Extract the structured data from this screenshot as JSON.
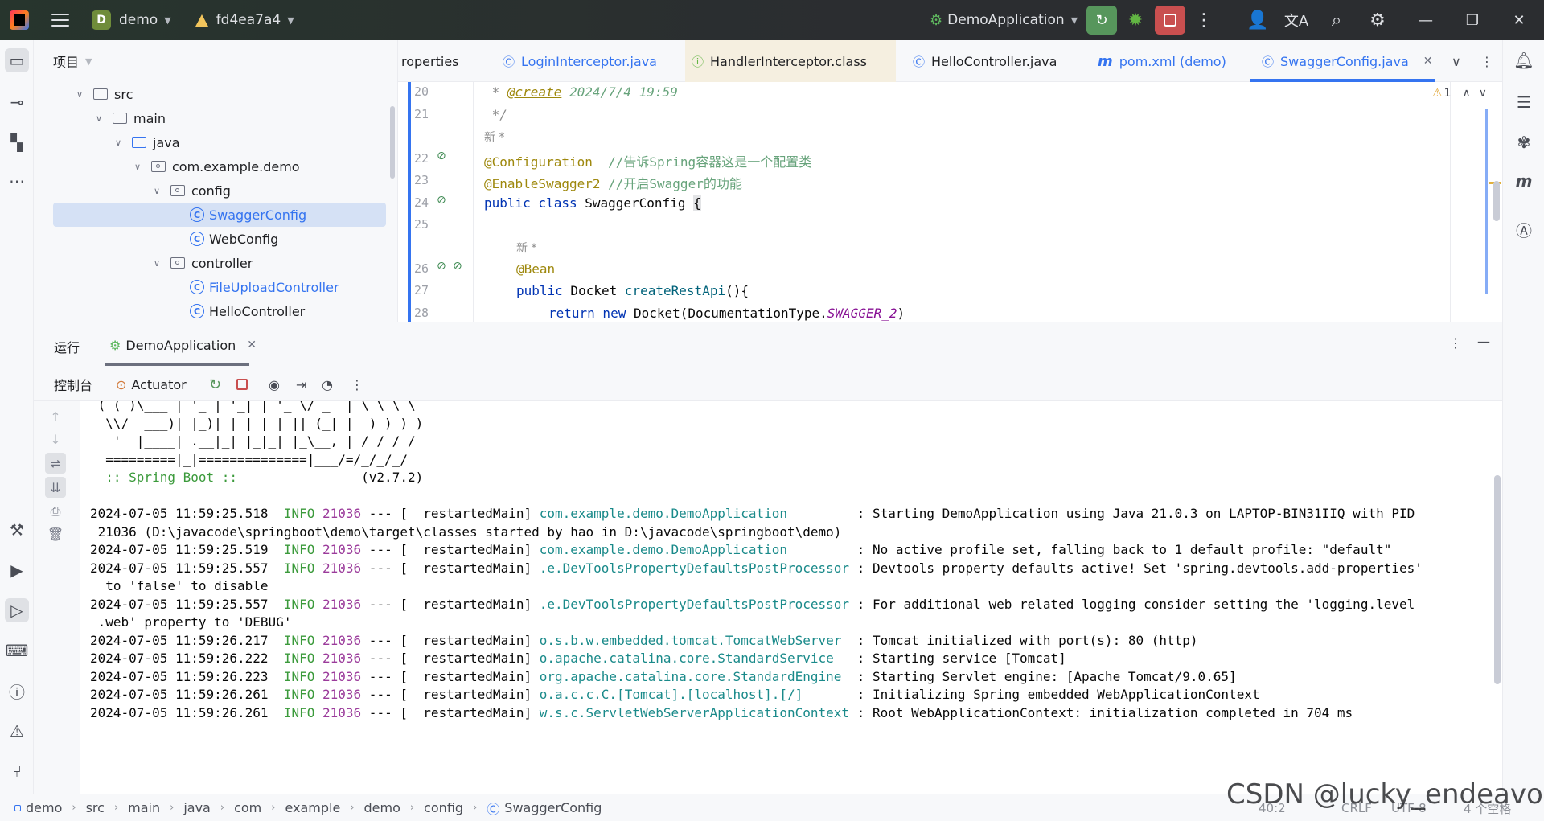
{
  "titlebar": {
    "project_badge": "D",
    "project_name": "demo",
    "branch": "fd4ea7a4",
    "run_config": "DemoApplication"
  },
  "project_panel": {
    "title": "项目",
    "tree": [
      {
        "label": "src",
        "kind": "folder"
      },
      {
        "label": "main",
        "kind": "folder"
      },
      {
        "label": "java",
        "kind": "src-folder"
      },
      {
        "label": "com.example.demo",
        "kind": "package"
      },
      {
        "label": "config",
        "kind": "package"
      },
      {
        "label": "SwaggerConfig",
        "kind": "class",
        "selected": true
      },
      {
        "label": "WebConfig",
        "kind": "class"
      },
      {
        "label": "controller",
        "kind": "package"
      },
      {
        "label": "FileUploadController",
        "kind": "class"
      },
      {
        "label": "HelloController",
        "kind": "class"
      }
    ]
  },
  "editor": {
    "tabs": [
      {
        "label": "roperties"
      },
      {
        "label": "LoginInterceptor.java"
      },
      {
        "label": "HandlerInterceptor.class"
      },
      {
        "label": "HelloController.java"
      },
      {
        "label": "pom.xml (demo)"
      },
      {
        "label": "SwaggerConfig.java",
        "active": true
      }
    ],
    "warning_count": "1",
    "line_numbers": [
      "20",
      "21",
      "22",
      "23",
      "24",
      "25",
      "26",
      "27",
      "28"
    ],
    "code": {
      "l20_prefix": " * ",
      "l20_tag": "@create",
      "l20_rest": " 2024/7/4 19:59",
      "l21": " */",
      "hint_new1": "新 *",
      "l22_ann": "@Configuration",
      "l22_cmt": "  //告诉Spring容器这是一个配置类",
      "l23_ann": "@EnableSwagger2",
      "l23_cmt": " //开启Swagger的功能",
      "l24_kw": "public class",
      "l24_name": " SwaggerConfig ",
      "l24_brace": "{",
      "hint_new2": "新 *",
      "l26_ann": "@Bean",
      "l27_kw": "public",
      "l27_type": " Docket ",
      "l27_fn": "createRestApi",
      "l27_rest": "(){",
      "l28_kw": "return new",
      "l28_mid": " Docket(DocumentationType.",
      "l28_const": "SWAGGER_2",
      "l28_end": ")"
    }
  },
  "run_panel": {
    "title": "运行",
    "tab": "DemoApplication",
    "toolbar": {
      "console": "控制台",
      "actuator": "Actuator"
    },
    "banner": [
      " ( ( )\\___ | '_ | '_| | '_ \\/ _` | \\ \\ \\ \\",
      "  \\\\/  ___)| |_)| | | | | || (_| |  ) ) ) )",
      "   '  |____| .__|_| |_|_| |_\\__, | / / / /",
      "  =========|_|==============|___/=/_/_/_/"
    ],
    "spring_boot_label": "  :: Spring Boot ::",
    "spring_boot_version": "                (v2.7.2)",
    "logs": [
      {
        "ts": "2024-07-05 11:59:25.518",
        "level": "INFO",
        "pid": "21036",
        "thread": " --- [  restartedMain] ",
        "logger": "com.example.demo.DemoApplication        ",
        "msg": " : Starting DemoApplication using Java 21.0.3 on LAPTOP-BIN31IIQ with PID",
        "cont": " 21036 (D:\\javacode\\springboot\\demo\\target\\classes started by hao in D:\\javacode\\springboot\\demo)"
      },
      {
        "ts": "2024-07-05 11:59:25.519",
        "level": "INFO",
        "pid": "21036",
        "thread": " --- [  restartedMain] ",
        "logger": "com.example.demo.DemoApplication        ",
        "msg": " : No active profile set, falling back to 1 default profile: \"default\""
      },
      {
        "ts": "2024-07-05 11:59:25.557",
        "level": "INFO",
        "pid": "21036",
        "thread": " --- [  restartedMain] ",
        "logger": ".e.DevToolsPropertyDefaultsPostProcessor",
        "msg": " : Devtools property defaults active! Set 'spring.devtools.add-properties'",
        "cont": "  to 'false' to disable"
      },
      {
        "ts": "2024-07-05 11:59:25.557",
        "level": "INFO",
        "pid": "21036",
        "thread": " --- [  restartedMain] ",
        "logger": ".e.DevToolsPropertyDefaultsPostProcessor",
        "msg": " : For additional web related logging consider setting the 'logging.level",
        "cont": " .web' property to 'DEBUG'"
      },
      {
        "ts": "2024-07-05 11:59:26.217",
        "level": "INFO",
        "pid": "21036",
        "thread": " --- [  restartedMain] ",
        "logger": "o.s.b.w.embedded.tomcat.TomcatWebServer ",
        "msg": " : Tomcat initialized with port(s): 80 (http)"
      },
      {
        "ts": "2024-07-05 11:59:26.222",
        "level": "INFO",
        "pid": "21036",
        "thread": " --- [  restartedMain] ",
        "logger": "o.apache.catalina.core.StandardService  ",
        "msg": " : Starting service [Tomcat]"
      },
      {
        "ts": "2024-07-05 11:59:26.223",
        "level": "INFO",
        "pid": "21036",
        "thread": " --- [  restartedMain] ",
        "logger": "org.apache.catalina.core.StandardEngine ",
        "msg": " : Starting Servlet engine: [Apache Tomcat/9.0.65]"
      },
      {
        "ts": "2024-07-05 11:59:26.261",
        "level": "INFO",
        "pid": "21036",
        "thread": " --- [  restartedMain] ",
        "logger": "o.a.c.c.C.[Tomcat].[localhost].[/]      ",
        "msg": " : Initializing Spring embedded WebApplicationContext"
      },
      {
        "ts": "2024-07-05 11:59:26.261",
        "level": "INFO",
        "pid": "21036",
        "thread": " --- [  restartedMain] ",
        "logger": "w.s.c.ServletWebServerApplicationContext",
        "msg": " : Root WebApplicationContext: initialization completed in 704 ms"
      }
    ]
  },
  "statusbar": {
    "breadcrumbs": [
      "demo",
      "src",
      "main",
      "java",
      "com",
      "example",
      "demo",
      "config",
      "SwaggerConfig"
    ],
    "position": "40:2",
    "line_sep": "CRLF",
    "encoding": "UTF-8",
    "indent": "4 个空格"
  },
  "watermark": "CSDN @lucky_endeavor",
  "colors": {
    "accent": "#3574f0",
    "run_green": "#57965c",
    "stop_red": "#c94f4f"
  }
}
